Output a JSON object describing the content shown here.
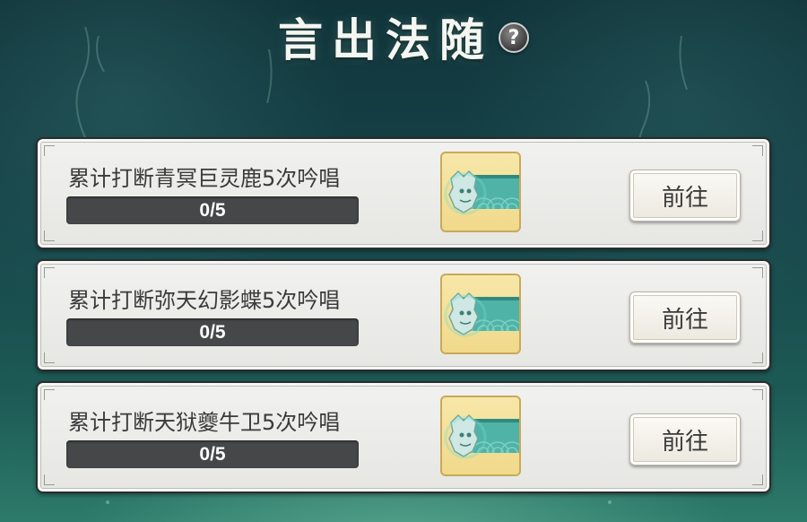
{
  "header": {
    "title": "言出法随",
    "help_label": "?"
  },
  "tasks": [
    {
      "title": "累计打断青冥巨灵鹿5次吟唱",
      "progress_text": "0/5",
      "progress_value": 0,
      "progress_max": 5,
      "reward_icon": "jade-beast-badge-icon",
      "button_label": "前往"
    },
    {
      "title": "累计打断弥天幻影蝶5次吟唱",
      "progress_text": "0/5",
      "progress_value": 0,
      "progress_max": 5,
      "reward_icon": "jade-beast-badge-icon",
      "button_label": "前往"
    },
    {
      "title": "累计打断天狱夔牛卫5次吟唱",
      "progress_text": "0/5",
      "progress_value": 0,
      "progress_max": 5,
      "reward_icon": "jade-beast-badge-icon",
      "button_label": "前往"
    }
  ],
  "colors": {
    "card_bg": "#eeeeeb",
    "progress_track": "#454749",
    "reward_slot_bg": "#f3df95",
    "teal_accent": "#4fb3a8"
  }
}
